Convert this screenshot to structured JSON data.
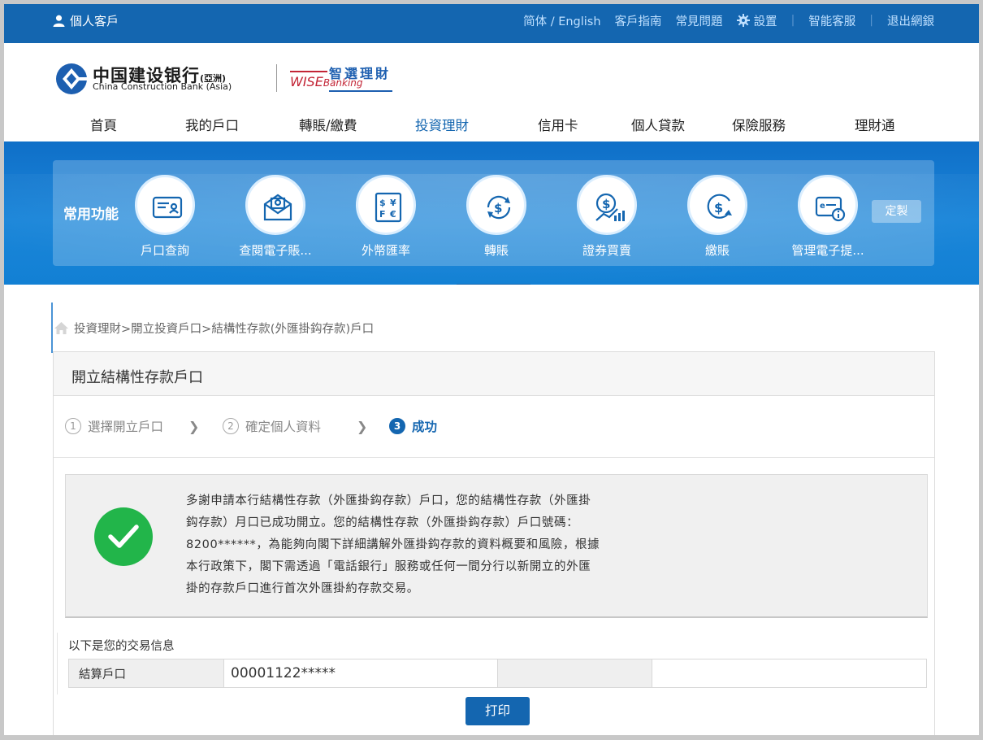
{
  "topbar": {
    "user_label": "個人客戶",
    "links": [
      "简体 / English",
      "客戶指南",
      "常見問題",
      "設置",
      "智能客服",
      "退出網銀"
    ]
  },
  "header": {
    "logo_cn": "中国建设银行",
    "logo_cn_suffix": "(亞洲)",
    "logo_en": "China Construction Bank (Asia)",
    "wise_zh": "智選理財",
    "wise_en": "WISE",
    "wise_en_small": "Banking"
  },
  "nav": {
    "items": [
      "首頁",
      "我的戶口",
      "轉賬/繳費",
      "投資理財",
      "信用卡",
      "個人貸款",
      "保險服務",
      "理財通"
    ],
    "active": "投資理財"
  },
  "quick": {
    "title": "常用功能",
    "items": [
      "戶口查詢",
      "查閱電子賬...",
      "外幣匯率",
      "轉賬",
      "證券買賣",
      "繳賬",
      "管理電子提..."
    ],
    "custom_label": "定製"
  },
  "breadcrumb": {
    "items": [
      "投資理財>",
      "開立投資戶口>",
      "結構性存款(外匯掛鈎存款)戶口"
    ]
  },
  "panel": {
    "title": "開立結構性存款戶口",
    "steps": [
      {
        "num": "1",
        "label": "選擇開立戶口"
      },
      {
        "num": "2",
        "label": "確定個人資料"
      },
      {
        "num": "3",
        "label": "成功"
      }
    ],
    "message_lines": [
      "多謝申請本行結構性存款（外匯掛鈎存款）戶口，您的結構性存款（外匯掛",
      "鈎存款）月口已成功開立。您的結構性存款（外匯掛鈎存款）戶口號碼：",
      "8200******，為能夠向閣下詳細講解外匯掛鈎存款的資料概要和風險，根據",
      "本行政策下，閣下需透過「電話銀行」服務或任何一間分行以新開立的外匯",
      "掛的存款戶口進行首次外匯掛約存款交易。"
    ],
    "info_header": "以下是您的交易信息",
    "info_key": "結算戶口",
    "info_value": "00001122*****",
    "print_label": "打印"
  },
  "colors": {
    "primary": "#1466b0",
    "success": "#22b54a",
    "brand_red": "#c32536"
  }
}
